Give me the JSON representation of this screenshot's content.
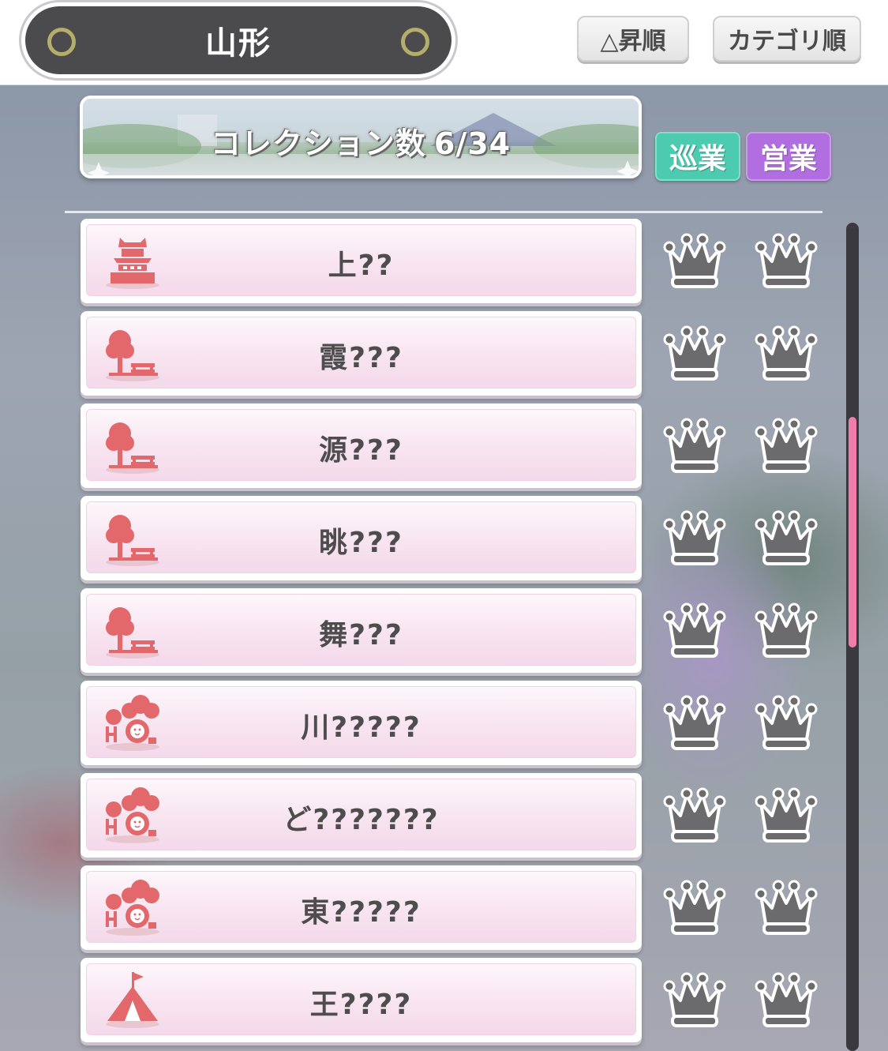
{
  "header": {
    "prefecture": "山形",
    "sort_ascending_label": "△昇順",
    "sort_category_label": "カテゴリ順"
  },
  "collection": {
    "label": "コレクション数",
    "count": "6/34"
  },
  "tags": {
    "junkou": "巡業",
    "eigyou": "営業"
  },
  "colors": {
    "crown": "#6b6b6d",
    "icon_red": "#e2686c",
    "junkou": "#4dcbb1",
    "eigyou": "#b06ee0",
    "scroll_thumb": "#f07eab"
  },
  "spots": [
    {
      "name": "上??",
      "icon": "castle-icon"
    },
    {
      "name": "霞???",
      "icon": "park-tree-bench-icon"
    },
    {
      "name": "源???",
      "icon": "park-tree-bench-icon"
    },
    {
      "name": "眺???",
      "icon": "park-tree-bench-icon"
    },
    {
      "name": "舞???",
      "icon": "park-tree-bench-icon"
    },
    {
      "name": "川?????",
      "icon": "zoo-lion-icon"
    },
    {
      "name": "ど???????",
      "icon": "zoo-lion-icon"
    },
    {
      "name": "東?????",
      "icon": "zoo-lion-icon"
    },
    {
      "name": "王????",
      "icon": "tent-icon"
    }
  ]
}
